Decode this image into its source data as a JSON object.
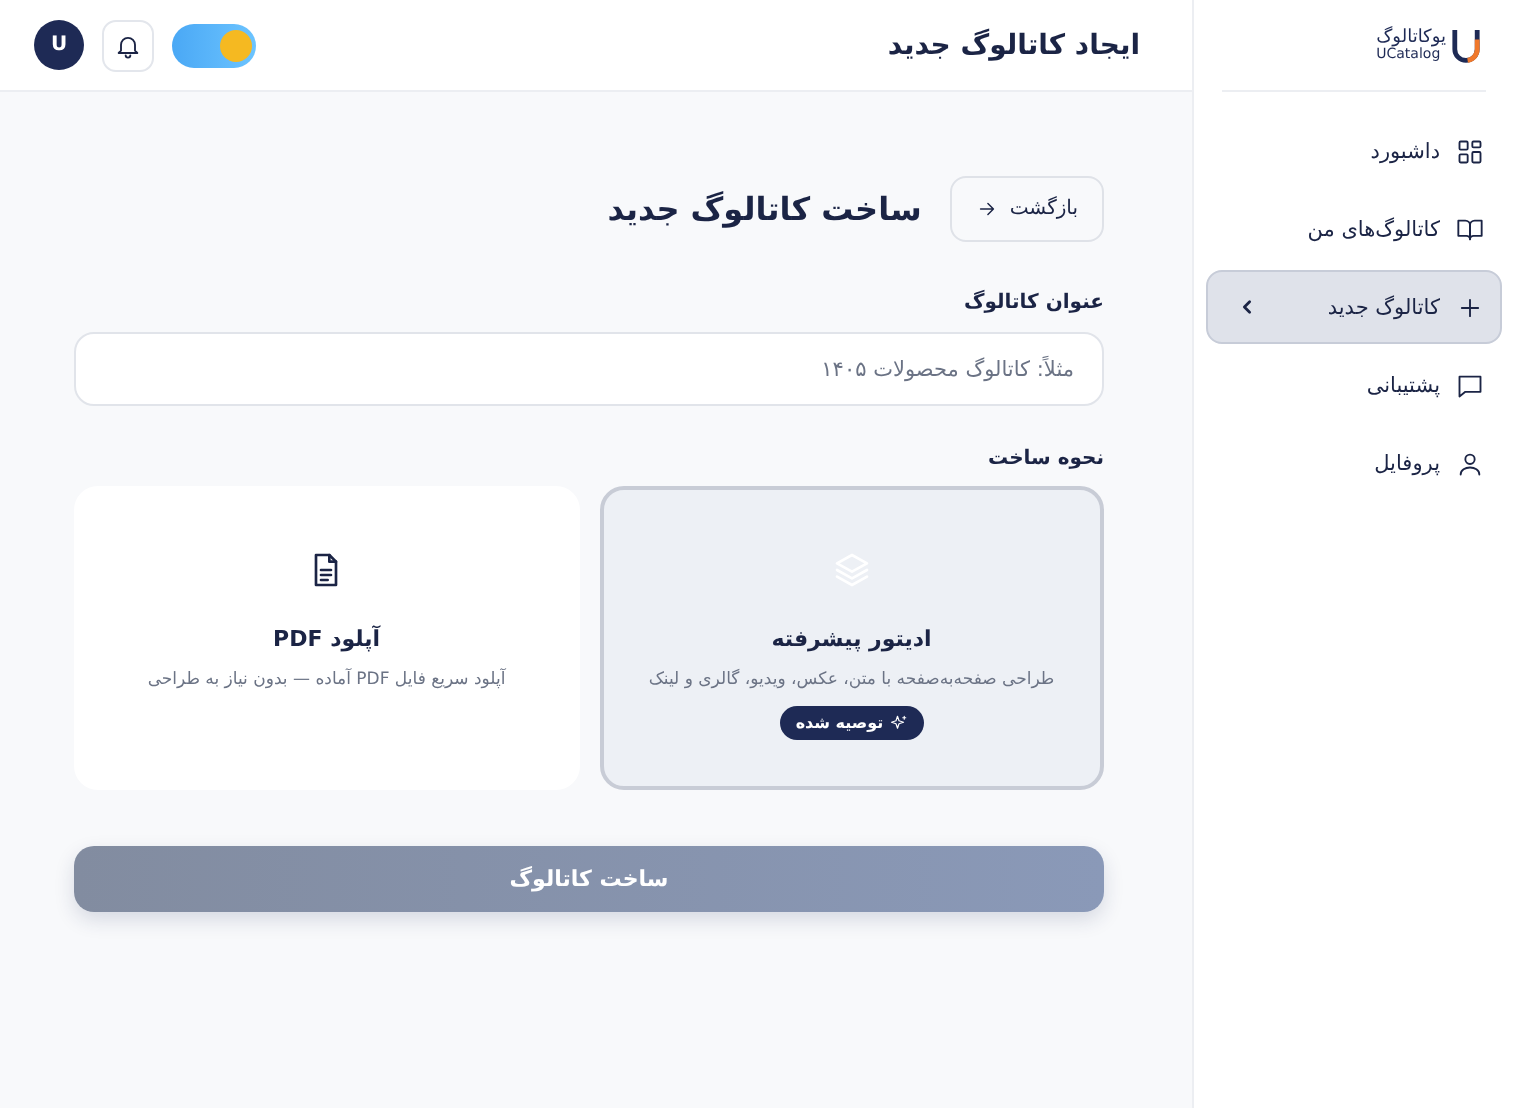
{
  "sidebar": {
    "logo": {
      "name": "یوکاتالوگ",
      "latin": "UCatalog"
    },
    "items": [
      {
        "label": "داشبورد",
        "selected": false
      },
      {
        "label": "کاتالوگ‌های من",
        "selected": false
      },
      {
        "label": "کاتالوگ جدید",
        "selected": true
      },
      {
        "label": "پشتیبانی",
        "selected": false
      },
      {
        "label": "پروفایل",
        "selected": false
      }
    ]
  },
  "header": {
    "title": "ایجاد کاتالوگ جدید",
    "theme_toggle": {
      "on": true
    },
    "avatar": "U"
  },
  "page": {
    "back_button": "بازگشت",
    "title": "ساخت کاتالوگ جدید",
    "title_field": {
      "label": "عنوان کاتالوگ",
      "placeholder": "مثلاً: کاتالوگ محصولات ۱۴۰۵"
    },
    "method_label": "نحوه ساخت",
    "methods": [
      {
        "title": "ادیتور پیشرفته",
        "description": "طراحی صفحه‌به‌صفحه با متن، عکس، ویدیو، گالری و لینک",
        "badge": "توصیه شده",
        "selected": true
      },
      {
        "title": "آپلود PDF",
        "description": "آپلود سریع فایل PDF آماده — بدون نیاز به طراحی",
        "selected": false
      }
    ],
    "submit": {
      "label": "ساخت کاتالوگ",
      "disabled": true
    }
  }
}
